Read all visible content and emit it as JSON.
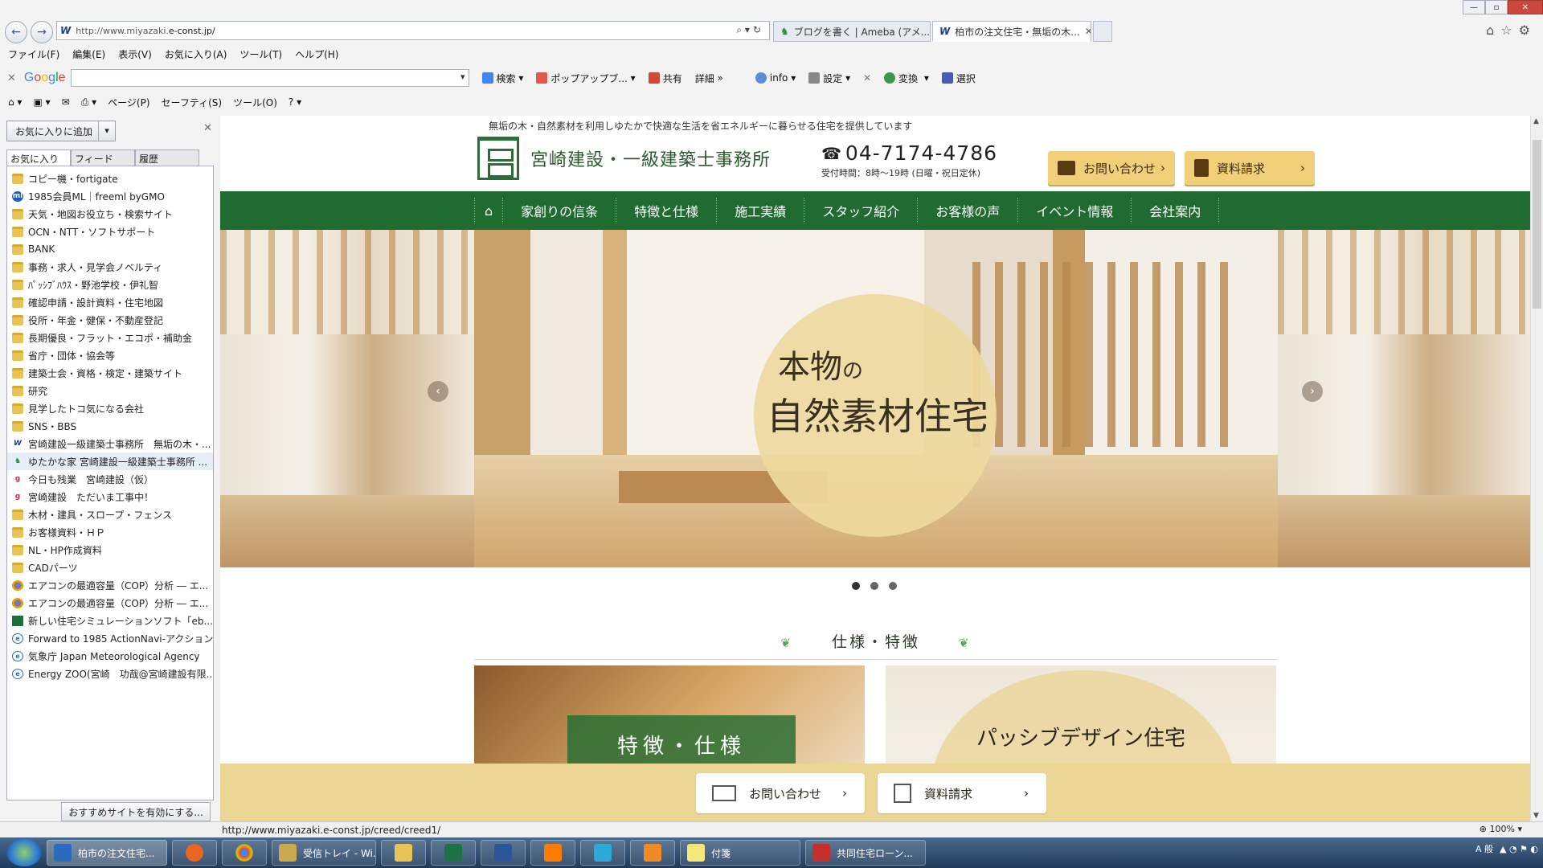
{
  "browser": {
    "address": "http://www.miyazaki.e-const.jp/",
    "address_domain": "e-const.jp/",
    "address_prefix": "http://www.miyazaki.",
    "tabs": [
      {
        "label": "ブログを書く | Ameba (アメ..."
      },
      {
        "label": "柏市の注文住宅・無垢の木..."
      }
    ],
    "menu": [
      "ファイル(F)",
      "編集(E)",
      "表示(V)",
      "お気に入り(A)",
      "ツール(T)",
      "ヘルプ(H)"
    ],
    "google": {
      "search_label": "検索",
      "popup_label": "ポップアップブ...",
      "share_label": "共有",
      "detail_label": "詳細",
      "info_label": "info",
      "settings_label": "設定",
      "convert_label": "変換",
      "select_label": "選択"
    },
    "commands": [
      "ページ(P)",
      "セーフティ(S)",
      "ツール(O)"
    ],
    "status_url": "http://www.miyazaki.e-const.jp/creed/creed1/",
    "zoom": "100%"
  },
  "sidebar": {
    "add_button": "お気に入りに追加",
    "tabs": [
      "お気に入り",
      "フィード",
      "履歴"
    ],
    "items": [
      {
        "label": "コピー機・fortigate",
        "icon": "folder"
      },
      {
        "label": "1985会員ML｜freeml byGMO",
        "icon": "ml"
      },
      {
        "label": "天気・地図お役立ち・検索サイト",
        "icon": "folder"
      },
      {
        "label": "OCN・NTT・ソフトサポート",
        "icon": "folder"
      },
      {
        "label": "BANK",
        "icon": "folder"
      },
      {
        "label": "事務・求人・見学会ノベルティ",
        "icon": "folder"
      },
      {
        "label": "ﾊﾟｯｼﾌﾞﾊｳｽ・野池学校・伊礼智",
        "icon": "folder"
      },
      {
        "label": "確認申請・設計資料・住宅地図",
        "icon": "folder"
      },
      {
        "label": "役所・年金・健保・不動産登記",
        "icon": "folder"
      },
      {
        "label": "長期優良・フラット・エコポ・補助金",
        "icon": "folder"
      },
      {
        "label": "省庁・団体・協会等",
        "icon": "folder"
      },
      {
        "label": "建築士会・資格・検定・建築サイト",
        "icon": "folder"
      },
      {
        "label": "研究",
        "icon": "folder"
      },
      {
        "label": "見学したトコ気になる会社",
        "icon": "folder"
      },
      {
        "label": "SNS・BBS",
        "icon": "folder"
      },
      {
        "label": "宮崎建設一級建築士事務所　無垢の木・...",
        "icon": "w"
      },
      {
        "label": "ゆたかな家 宮崎建設一級建築士事務所 ...",
        "icon": "ameba"
      },
      {
        "label": "今日も残業　宮崎建設（仮）",
        "icon": "g"
      },
      {
        "label": "宮崎建設　ただいま工事中！",
        "icon": "g"
      },
      {
        "label": "木材・建具・スロープ・フェンス",
        "icon": "folder"
      },
      {
        "label": "お客様資料・ＨＰ",
        "icon": "folder"
      },
      {
        "label": "NL・HP作成資料",
        "icon": "folder"
      },
      {
        "label": "CADパーツ",
        "icon": "folder"
      },
      {
        "label": "エアコンの最適容量（COP）分析 ― エ...",
        "icon": "ch"
      },
      {
        "label": "エアコンの最適容量（COP）分析 ― エ...",
        "icon": "ch"
      },
      {
        "label": "新しい住宅シミュレーションソフト「eb...",
        "icon": "doc"
      },
      {
        "label": "Forward to 1985 ActionNavi-アクション...",
        "icon": "ie"
      },
      {
        "label": "気象庁 Japan Meteorological Agency",
        "icon": "ie"
      },
      {
        "label": "Energy ZOO(宮崎　功哉@宮崎建設有限...",
        "icon": "ie"
      }
    ],
    "bottom_button": "おすすめサイトを有効にする..."
  },
  "site": {
    "tagline": "無垢の木・自然素材を利用しゆたかで快適な生活を省エネルギーに暮らせる住宅を提供しています",
    "company": "宮崎建設・一級建築士事務所",
    "tel": "04-7174-4786",
    "hours": "受付時間：8時〜19時 (日曜・祝日定休)",
    "contact_button": "お問い合わせ",
    "request_button": "資料請求",
    "nav": [
      "家創りの信条",
      "特徴と仕様",
      "施工実績",
      "スタッフ紹介",
      "お客様の声",
      "イベント情報",
      "会社案内"
    ],
    "hero_line1": "本物",
    "hero_no": "の",
    "hero_line2": "自然素材住宅",
    "section_title": "仕様・特徴",
    "card1_label": "特徴・仕様",
    "card2_label": "パッシブデザイン住宅",
    "footer_contact": "お問い合わせ",
    "footer_request": "資料請求",
    "accent_green": "#1f6b30",
    "accent_gold": "#f1cf78"
  },
  "taskbar": {
    "items": [
      {
        "label": "柏市の注文住宅...",
        "icon": "ie-icon"
      },
      {
        "label": "受信トレイ - Wi...",
        "icon": "mail-icon"
      },
      {
        "label": "付箋",
        "icon": "sticky-icon"
      },
      {
        "label": "共同住宅ローン...",
        "icon": "pdf-icon"
      }
    ]
  }
}
